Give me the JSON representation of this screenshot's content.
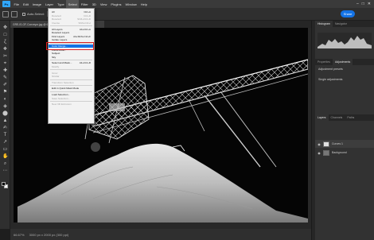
{
  "app": {
    "logo": "Ps",
    "accent": "#31a8ff"
  },
  "menubar": {
    "items": [
      "File",
      "Edit",
      "Image",
      "Layer",
      "Type",
      "Select",
      "Filter",
      "3D",
      "View",
      "Plugins",
      "Window",
      "Help"
    ],
    "active": "Select"
  },
  "options": {
    "auto_select_label": "Auto-Select:",
    "share_label": "Share"
  },
  "document_tab": {
    "title": "GRE-IS-GF-Conveyor.jpg @ 66.7% (Layer 0, Gray/8) *"
  },
  "select_menu": {
    "highlight_color": "#1473e6",
    "items": [
      {
        "label": "All",
        "shortcut": "Ctrl+A",
        "disabled": false
      },
      {
        "label": "Deselect",
        "shortcut": "Ctrl+D",
        "disabled": true
      },
      {
        "label": "Reselect",
        "shortcut": "Shift+Ctrl+D",
        "disabled": true
      },
      {
        "label": "Inverse",
        "shortcut": "Shift+Ctrl+I",
        "disabled": true
      },
      {
        "sep": true
      },
      {
        "label": "All Layers",
        "shortcut": "Alt+Ctrl+A",
        "disabled": false
      },
      {
        "label": "Deselect Layers",
        "shortcut": "",
        "disabled": false
      },
      {
        "label": "Find Layers",
        "shortcut": "Alt+Shift+Ctrl+F",
        "disabled": false
      },
      {
        "label": "Isolate Layers",
        "shortcut": "",
        "disabled": false
      },
      {
        "sep": true
      },
      {
        "label": "Color Range...",
        "shortcut": "",
        "disabled": false,
        "highlighted": true
      },
      {
        "label": "Focus Area...",
        "shortcut": "",
        "disabled": false
      },
      {
        "label": "Subject",
        "shortcut": "",
        "disabled": false
      },
      {
        "label": "Sky",
        "shortcut": "",
        "disabled": false
      },
      {
        "sep": true
      },
      {
        "label": "Select and Mask...",
        "shortcut": "Alt+Ctrl+R",
        "disabled": false
      },
      {
        "label": "Modify",
        "shortcut": "",
        "disabled": true
      },
      {
        "sep": true
      },
      {
        "label": "Grow",
        "shortcut": "",
        "disabled": true
      },
      {
        "label": "Similar",
        "shortcut": "",
        "disabled": true
      },
      {
        "sep": true
      },
      {
        "label": "Transform Selection",
        "shortcut": "",
        "disabled": true
      },
      {
        "sep": true
      },
      {
        "label": "Edit in Quick Mask Mode",
        "shortcut": "",
        "disabled": false
      },
      {
        "sep": true
      },
      {
        "label": "Load Selection...",
        "shortcut": "",
        "disabled": false
      },
      {
        "label": "Save Selection...",
        "shortcut": "",
        "disabled": true
      },
      {
        "sep": true
      },
      {
        "label": "New 3D Extrusion",
        "shortcut": "",
        "disabled": true
      }
    ]
  },
  "panels": {
    "top_tabs": [
      "Histogram",
      "Navigator"
    ],
    "mid_tabs": [
      "Properties",
      "Adjustments"
    ],
    "adjust_rows": [
      "Adjustment presets",
      "Single adjustments"
    ],
    "layer_tabs": [
      "Layers",
      "Channels",
      "Paths"
    ],
    "layers": [
      {
        "name": "Curves 1"
      },
      {
        "name": "Background"
      }
    ]
  },
  "status": {
    "zoom": "66.67%",
    "doc_info": "3000 px x 2000 px (300 ppi)"
  }
}
